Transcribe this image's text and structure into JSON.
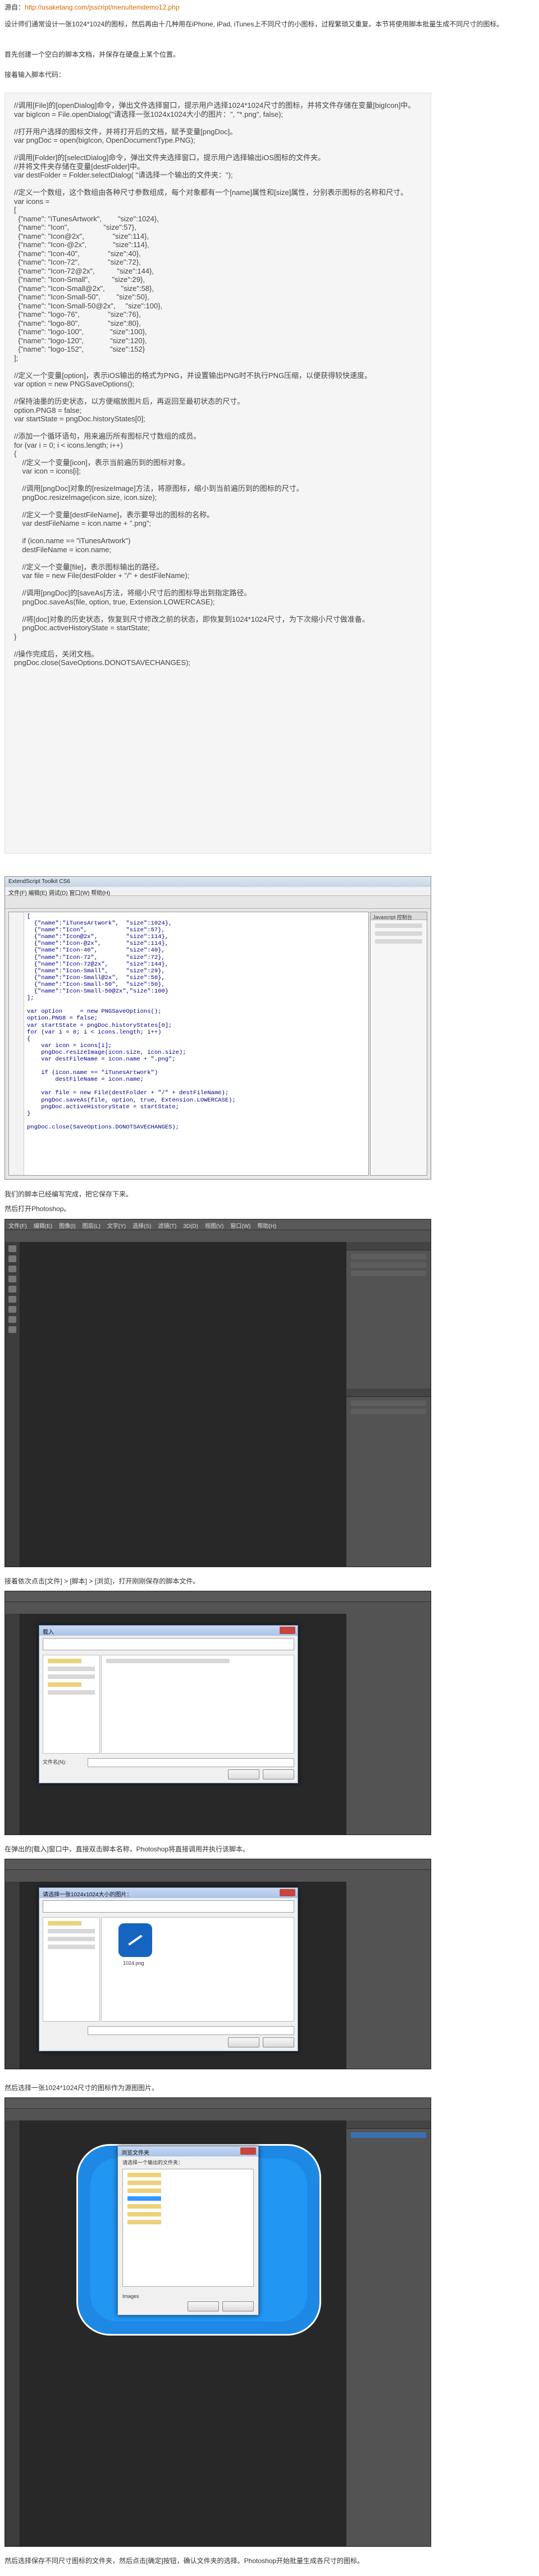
{
  "intro": {
    "source_label": "源自：",
    "source_url": "http://usaketang.com/jsscript/menuItemdemo12.php",
    "p1": "设计师们通常设计一张1024*1024的图标，然后再由十几种用在iPhone, iPad, iTunes上不同尺寸的小图标，过程繁琐又重复。本节将使用脚本批量生成不同尺寸的图标。",
    "p2": "首先创建一个空白的脚本文档，并保存在硬盘上某个位置。",
    "p3": "接着输入脚本代码："
  },
  "code": "//调用[File]的[openDialog]命令，弹出文件选择窗口，提示用户选择1024*1024尺寸的图标，并将文件存储在变量[bigIcon]中。\nvar bigIcon = File.openDialog(\"请选择一张1024x1024大小的图片：\", \"*.png\", false);\n\n//打开用户选择的图标文件，并将打开后的文档，赋予变量[pngDoc]。\nvar pngDoc = open(bigIcon, OpenDocumentType.PNG);\n\n//调用[Folder]的[selectDialog]命令，弹出文件夹选择窗口，提示用户选择输出iOS图标的文件夹。\n//并将文件夹存储在变量[destFolder]中。\nvar destFolder = Folder.selectDialog( \"请选择一个输出的文件夹：\");\n\n//定义一个数组，这个数组由各种尺寸参数组成，每个对象都有一个[name]属性和[size]属性，分别表示图标的名称和尺寸。\nvar icons =\n[\n  {\"name\": \"iTunesArtwork\",        \"size\":1024},\n  {\"name\": \"Icon\",                 \"size\":57},\n  {\"name\": \"Icon@2x\",              \"size\":114},\n  {\"name\": \"Icon-@2x\",             \"size\":114},\n  {\"name\": \"Icon-40\",              \"size\":40},\n  {\"name\": \"Icon-72\",              \"size\":72},\n  {\"name\": \"Icon-72@2x\",           \"size\":144},\n  {\"name\": \"Icon-Small\",           \"size\":29},\n  {\"name\": \"Icon-Small@2x\",        \"size\":58},\n  {\"name\": \"Icon-Small-50\",        \"size\":50},\n  {\"name\": \"Icon-Small-50@2x\",     \"size\":100},\n  {\"name\": \"logo-76\",              \"size\":76},\n  {\"name\": \"logo-80\",              \"size\":80},\n  {\"name\": \"logo-100\",             \"size\":100},\n  {\"name\": \"logo-120\",             \"size\":120},\n  {\"name\": \"logo-152\",             \"size\":152}\n];\n\n//定义一个变量[option]，表示iOS输出的格式为PNG，并设置输出PNG时不执行PNG压缩，以便获得较快速度。\nvar option = new PNGSaveOptions();\n\n//保持油墨的历史状态，以方便缩放图片后，再返回至最初状态的尺寸。\noption.PNG8 = false;\nvar startState = pngDoc.historyStates[0];\n\n//添加一个循环语句，用来遍历所有图标尺寸数组的成员。\nfor (var i = 0; i < icons.length; i++)\n{\n    //定义一个变量[icon]，表示当前遍历到的图标对象。\n    var icon = icons[i];\n\n    //调用[pngDoc]对象的[resizeImage]方法，将原图标，缩小到当前遍历到的图标的尺寸。\n    pngDoc.resizeImage(icon.size, icon.size);\n\n    //定义一个变量[destFileName]，表示要导出的图标的名称。\n    var destFileName = icon.name + \".png\";\n\n    if (icon.name == \"iTunesArtwork\")\n    destFileName = icon.name;\n\n    //定义一个变量[file]，表示图标输出的路径。\n    var file = new File(destFolder + \"/\" + destFileName);\n\n    //调用[pngDoc]的[saveAs]方法，将缩小尺寸后的图标导出到指定路径。\n    pngDoc.saveAs(file, option, true, Extension.LOWERCASE);\n\n    //将[doc]对象的历史状态，恢复到尺寸修改之前的状态，即恢复到1024*1024尺寸，为下次缩小尺寸做准备。\n    pngDoc.activeHistoryState = startState;\n}\n\n//操作完成后，关闭文档。\npngDoc.close(SaveOptions.DONOTSAVECHANGES);",
  "estk": {
    "title": "ExtendScript Toolkit CS6",
    "menu": "文件(F)   编辑(E)   调试(D)   窗口(W)   帮助(H)",
    "side_title": "Javascript 控制台",
    "code": "[\n  {\"name\":\"iTunesArtwork\",  \"size\":1024},\n  {\"name\":\"Icon\",           \"size\":57},\n  {\"name\":\"Icon@2x\",        \"size\":114},\n  {\"name\":\"Icon-@2x\",       \"size\":114},\n  {\"name\":\"Icon-40\",        \"size\":40},\n  {\"name\":\"Icon-72\",        \"size\":72},\n  {\"name\":\"Icon-72@2x\",     \"size\":144},\n  {\"name\":\"Icon-Small\",     \"size\":29},\n  {\"name\":\"Icon-Small@2x\",  \"size\":58},\n  {\"name\":\"Icon-Small-50\",  \"size\":50},\n  {\"name\":\"Icon-Small-50@2x\",\"size\":100}\n];\n\nvar option     = new PNGSaveOptions();\noption.PNG8 = false;\nvar startState = pngDoc.historyStates[0];\nfor (var i = 0; i < icons.length; i++)\n{\n    var icon = icons[i];\n    pngDoc.resizeImage(icon.size, icon.size);\n    var destFileName = icon.name + \".png\";\n\n    if (icon.name == \"iTunesArtwork\")\n        destFileName = icon.name;\n\n    var file = new File(destFolder + \"/\" + destFileName);\n    pngDoc.saveAs(file, option, true, Extension.LOWERCASE);\n    pngDoc.activeHistoryState = startState;\n}\n\npngDoc.close(SaveOptions.DONOTSAVECHANGES);"
  },
  "p_save": "我们的脚本已经编写完成，把它保存下来。",
  "p_open_ps": "然后打开Photoshop。",
  "p_menu": "接着依次点击[文件] > [脚本] > [浏览]，打开刚刚保存的脚本文件。",
  "p_select": "在弹出的[载入]窗口中，直接双击脚本名称，Photoshop将直接调用并执行该脚本。",
  "p_pick_icon": "然后选择一张1024*1024尺寸的图标作为源图图片。",
  "p_last": "然后选择保存不同尺寸图标的文件夹，然后点击[确定]按钮，确认文件夹的选择。Photoshop开始批量生成各尺寸的图标。",
  "ps_menu": [
    "文件(F)",
    "编辑(E)",
    "图像(I)",
    "图层(L)",
    "文字(Y)",
    "选择(S)",
    "滤镜(T)",
    "3D(D)",
    "视图(V)",
    "窗口(W)",
    "帮助(H)"
  ],
  "dialog1": {
    "title": "载入",
    "file_label": "文件名(N):",
    "ok": "载入(L)",
    "cancel": "取消"
  },
  "dialog2": {
    "title": "请选择一张1024x1024大小的图片：",
    "file_name": "1024.png",
    "ok": "打开(O)",
    "cancel": "取消"
  },
  "dialog3": {
    "title": "浏览文件夹",
    "prompt": "请选择一个输出的文件夹：",
    "folder": "Images",
    "ok": "确定",
    "cancel": "取消"
  }
}
